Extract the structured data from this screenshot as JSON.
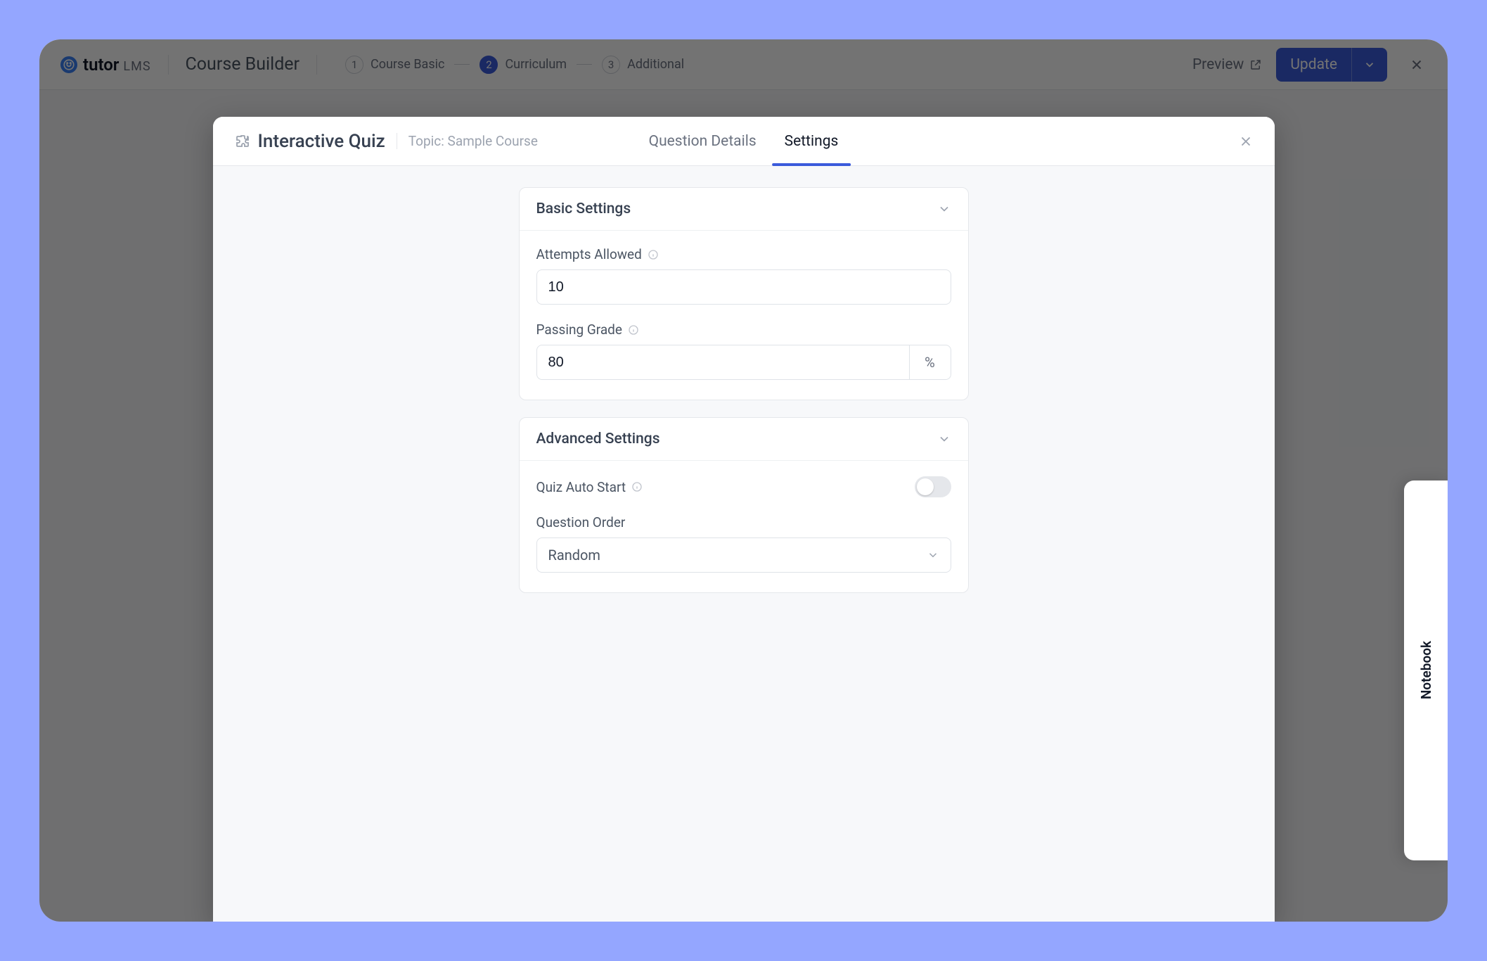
{
  "brand": {
    "name_main": "tutor",
    "name_sub": "LMS"
  },
  "header": {
    "course_builder_label": "Course Builder",
    "steps": [
      {
        "num": "1",
        "label": "Course Basic"
      },
      {
        "num": "2",
        "label": "Curriculum"
      },
      {
        "num": "3",
        "label": "Additional"
      }
    ],
    "active_step_index": 1,
    "preview_label": "Preview",
    "update_label": "Update"
  },
  "modal": {
    "title": "Interactive Quiz",
    "topic_prefix": "Topic:",
    "topic_name": "Sample Course",
    "tabs": {
      "question_details": "Question Details",
      "settings": "Settings"
    },
    "active_tab": "settings"
  },
  "basic_settings": {
    "section_title": "Basic Settings",
    "attempts_allowed_label": "Attempts Allowed",
    "attempts_allowed_value": "10",
    "passing_grade_label": "Passing Grade",
    "passing_grade_value": "80",
    "passing_grade_suffix": "%"
  },
  "advanced_settings": {
    "section_title": "Advanced Settings",
    "quiz_auto_start_label": "Quiz Auto Start",
    "quiz_auto_start_on": false,
    "question_order_label": "Question Order",
    "question_order_value": "Random"
  },
  "notebook": {
    "label": "Notebook"
  },
  "colors": {
    "accent": "#3b5bdb",
    "bg": "#94a6ff"
  }
}
